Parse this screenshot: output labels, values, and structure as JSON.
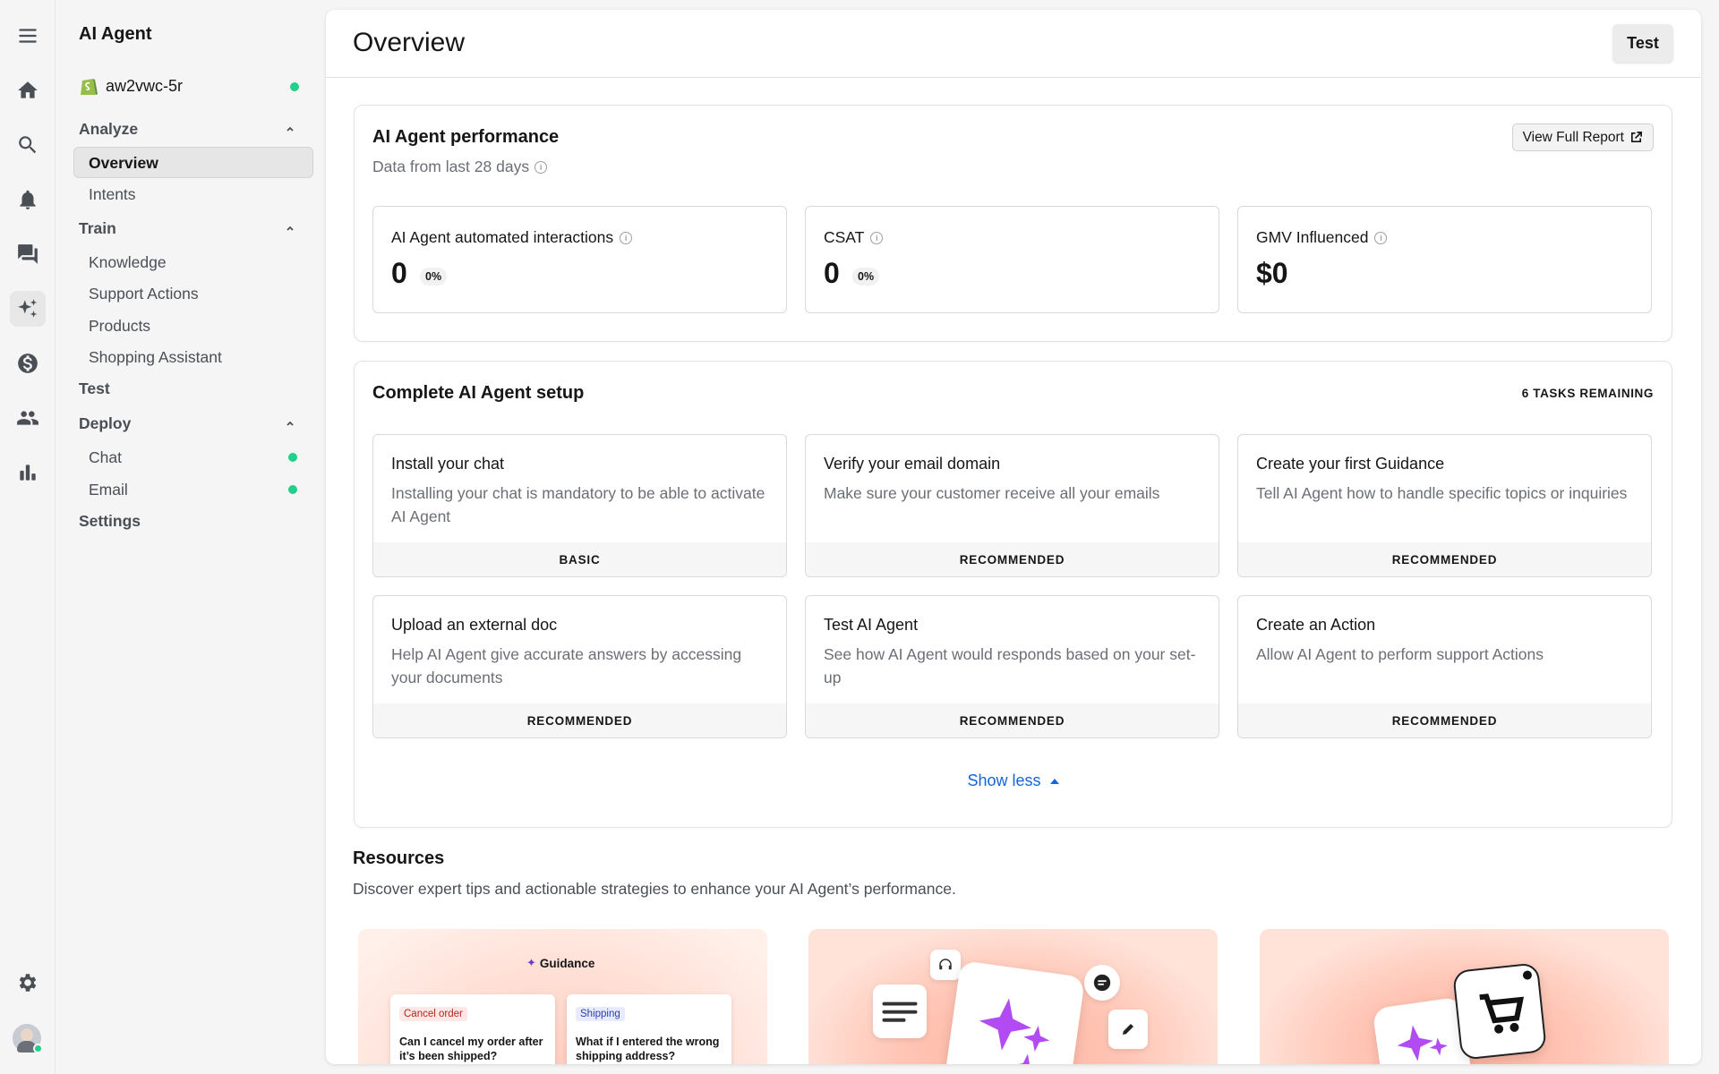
{
  "nav": {
    "title": "AI Agent",
    "store_name": "aw2vwc-5r",
    "sections": {
      "analyze": "Analyze",
      "train": "Train",
      "test": "Test",
      "deploy": "Deploy",
      "settings": "Settings"
    },
    "analyze_items": [
      "Overview",
      "Intents"
    ],
    "train_items": [
      "Knowledge",
      "Support Actions",
      "Products",
      "Shopping Assistant"
    ],
    "deploy_items": [
      "Chat",
      "Email"
    ]
  },
  "rail": {
    "icons": [
      "menu-icon",
      "home-icon",
      "search-icon",
      "bell-icon",
      "chat-icon",
      "sparkles-icon",
      "dollar-icon",
      "users-icon",
      "bar-chart-icon",
      "gear-icon"
    ]
  },
  "header": {
    "title": "Overview",
    "test_button": "Test"
  },
  "performance": {
    "title": "AI Agent performance",
    "subtitle": "Data from last 28 days",
    "report_button": "View Full Report",
    "metrics": [
      {
        "label": "AI Agent automated interactions",
        "value": "0",
        "pct": "0%"
      },
      {
        "label": "CSAT",
        "value": "0",
        "pct": "0%"
      },
      {
        "label": "GMV Influenced",
        "value": "$0",
        "pct": ""
      }
    ]
  },
  "setup": {
    "title": "Complete AI Agent setup",
    "remaining": "6 TASKS REMAINING",
    "tasks": [
      {
        "title": "Install your chat",
        "desc": "Installing your chat is mandatory to be able to activate AI Agent",
        "tag": "BASIC"
      },
      {
        "title": "Verify your email domain",
        "desc": "Make sure your customer receive all your emails",
        "tag": "RECOMMENDED"
      },
      {
        "title": "Create your first Guidance",
        "desc": "Tell AI Agent how to handle specific topics or inquiries",
        "tag": "RECOMMENDED"
      },
      {
        "title": "Upload an external doc",
        "desc": "Help AI Agent give accurate answers by accessing your documents",
        "tag": "RECOMMENDED"
      },
      {
        "title": "Test AI Agent",
        "desc": "See how AI Agent would responds based on your set-up",
        "tag": "RECOMMENDED"
      },
      {
        "title": "Create an Action",
        "desc": "Allow AI Agent to perform support Actions",
        "tag": "RECOMMENDED"
      }
    ],
    "toggle": "Show less"
  },
  "resources": {
    "title": "Resources",
    "subtitle": "Discover expert tips and actionable strategies to enhance your AI Agent’s performance.",
    "card1": {
      "label": "Guidance",
      "left_tag": "Cancel order",
      "left_text": "Can I cancel my order after it’s been shipped?",
      "right_tag": "Shipping",
      "right_text": "What if I entered the wrong shipping address?"
    }
  },
  "colors": {
    "accent_link": "#1565d8",
    "status_green": "#1fd18b",
    "sparkle_purple": "#b24bf3"
  }
}
